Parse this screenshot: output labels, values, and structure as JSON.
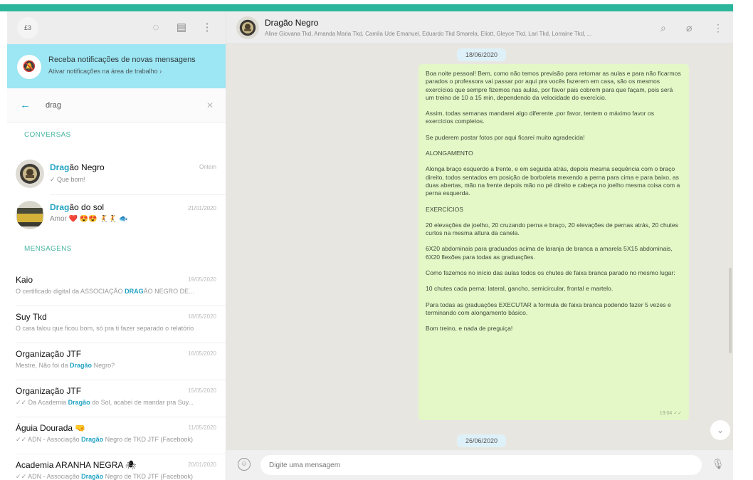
{
  "left": {
    "avatar_text": "£3",
    "notify": {
      "title": "Receba notificações de novas mensagens",
      "subtitle": "Ativar notificações na área de trabalho ›"
    },
    "search": {
      "value": "drag",
      "placeholder": ""
    },
    "sections": {
      "chats": "CONVERSAS",
      "messages": "MENSAGENS"
    },
    "chats": [
      {
        "title_hl": "Drag",
        "title_rest": "ão Negro",
        "subtitle": "✓ Que bom!",
        "time": "Ontem"
      },
      {
        "title_hl": "Drag",
        "title_rest": "ão do sol",
        "subtitle": "Amor ❤️ 😍😍 🤾🤾 🐟",
        "time": "21/01/2020"
      }
    ],
    "messages": [
      {
        "title": "Kaio",
        "time": "19/05/2020",
        "pre": "O certificado digital da ASSOCIAÇÃO ",
        "hl": "DRAG",
        "post": "ÃO NEGRO DE..."
      },
      {
        "title": "Suy Tkd",
        "time": "18/05/2020",
        "pre": "O cara falou que ficou bom, só pra ti fazer separado o relatório",
        "hl": "",
        "post": ""
      },
      {
        "title": "Organização JTF",
        "time": "16/05/2020",
        "pre": "Mestre, Não foi da ",
        "hl": "Dragão",
        "post": " Negro?"
      },
      {
        "title": "Organização JTF",
        "time": "15/05/2020",
        "pre": "✓✓ Da Academia ",
        "hl": "Dragão",
        "post": " do Sol, acabei de mandar pra Suy..."
      },
      {
        "title": "Águia Dourada 🤜",
        "time": "11/05/2020",
        "pre": "✓✓ ADN - Associação ",
        "hl": "Dragão",
        "post": " Negro de TKD JTF (Facebook)"
      },
      {
        "title": "Academia ARANHA NEGRA 🕷",
        "time": "20/01/2020",
        "pre": "✓✓ ADN - Associação ",
        "hl": "Dragão",
        "post": " Negro de TKD JTF (Facebook)"
      }
    ]
  },
  "chat": {
    "title": "Dragão Negro",
    "members": "Aline Giovana Tkd, Amanda Maria Tkd, Camila Ude Emanuel, Eduardo Tkd Smarela, Eliott, Gleyce Tkd, Lari Tkd, Lorraine Tkd, ...",
    "date1": "18/06/2020",
    "date2": "26/06/2020",
    "paragraphs": [
      "Boa noite pessoal! Bem, como não temos previsão para retornar as aulas e para não ficarmos parados o professora vai passar por aqui pra vocês fazerem em casa, são os mesmos exercícios que sempre fizemos nas aulas, por favor pais cobrem para que façam, pois será um treino de 10 a 15 min, dependendo da velocidade do exercício.",
      "Assim, todas semanas mandarei algo diferente ,por favor, tentem o máximo favor os exercícios completos.",
      "Se puderem postar fotos por aqui ficarei muito agradecida!",
      "ALONGAMENTO",
      "Alonga braço esquerdo a frente, e em seguida atrás, depois mesma sequência com o braço direito, todos sentados em posição de borboleta mexendo a perna para cima e para baixo, as duas abertas, mão na frente depois mão no pé direito e cabeça no joelho mesma coisa com a perna esquerda.",
      "EXERCÍCIOS",
      "20 elevações de joelho, 20 cruzando perna e braço, 20 elevações de pernas atrás, 20 chutes curtos na mesma altura da canela.",
      "6X20 abdominais para graduados acima de laranja de branca a amarela 5X15 abdominais, 6X20 flexões para todas as graduações.",
      "Como fazemos no início das aulas todos os chutes de faixa branca parado no mesmo lugar:",
      "10 chutes cada perna: lateral, gancho, semicircular, frontal e martelo.",
      "Para todas as graduações EXECUTAR a formula de faixa branca podendo fazer 5 vezes e terminando com alongamento básico.",
      "Bom treino, e nada de preguiça!"
    ],
    "bubble_time": "19:04 ✓✓",
    "input_placeholder": "Digite uma mensagem"
  },
  "icons": {
    "status": "◌",
    "new_chat": "▤",
    "menu": "⋮",
    "back": "←",
    "clear": "✕",
    "bell": "🔕",
    "search": "⌕",
    "attach": "⌀",
    "emoji": "☺",
    "mic": "🎙",
    "chevron": "⌄"
  },
  "colors": {
    "accent": "#2bb59a",
    "highlight": "#21a3c4",
    "bubble": "#e3f7c7",
    "notify": "#9de6f3"
  }
}
